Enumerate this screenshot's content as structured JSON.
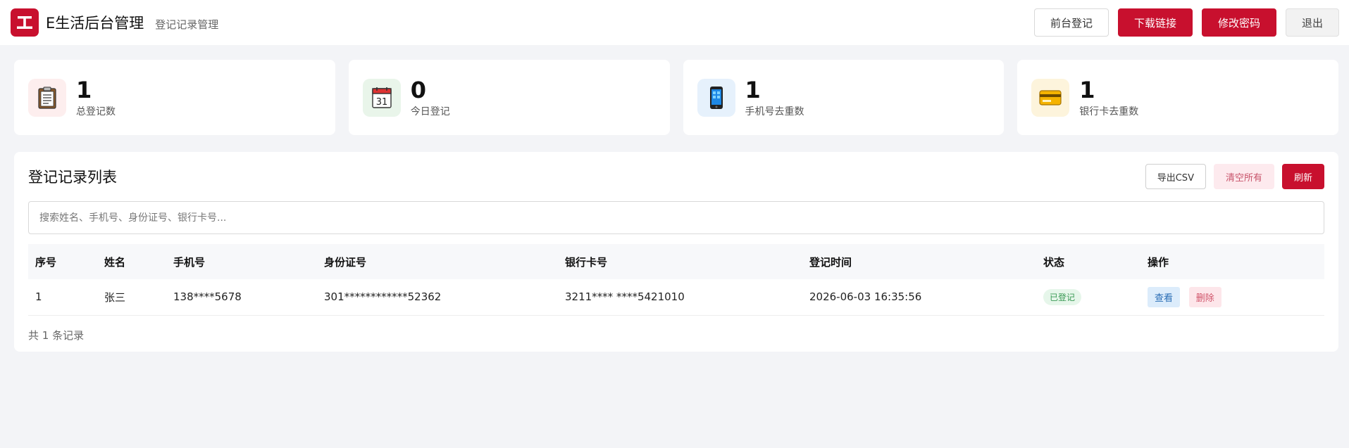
{
  "header": {
    "logo_char": "工",
    "title": "E生活后台管理",
    "subtitle": "登记记录管理",
    "buttons": {
      "front": "前台登记",
      "download": "下载链接",
      "password": "修改密码",
      "logout": "退出"
    }
  },
  "stats": [
    {
      "value": "1",
      "label": "总登记数",
      "icon": "clipboard-icon",
      "bg": "#fdeeee"
    },
    {
      "value": "0",
      "label": "今日登记",
      "icon": "calendar-icon",
      "bg": "#e9f5ea"
    },
    {
      "value": "1",
      "label": "手机号去重数",
      "icon": "phone-icon",
      "bg": "#e6f1fc"
    },
    {
      "value": "1",
      "label": "银行卡去重数",
      "icon": "card-icon",
      "bg": "#fdf4dc"
    }
  ],
  "calendar_day": "31",
  "panel": {
    "title": "登记记录列表",
    "buttons": {
      "export": "导出CSV",
      "clear": "清空所有",
      "refresh": "刷新"
    },
    "search_placeholder": "搜索姓名、手机号、身份证号、银行卡号...",
    "columns": [
      "序号",
      "姓名",
      "手机号",
      "身份证号",
      "银行卡号",
      "登记时间",
      "状态",
      "操作"
    ],
    "rows": [
      {
        "index": "1",
        "name": "张三",
        "phone": "138****5678",
        "id_number": "301************52362",
        "bank_card": "3211**** ****5421010",
        "time": "2026-06-03 16:35:56",
        "status": "已登记",
        "view": "查看",
        "delete": "删除"
      }
    ],
    "total_text": "共 1 条记录"
  },
  "colors": {
    "brand": "#c8102e",
    "page_bg": "#f3f4f7",
    "status_green": "#3a9a55"
  }
}
